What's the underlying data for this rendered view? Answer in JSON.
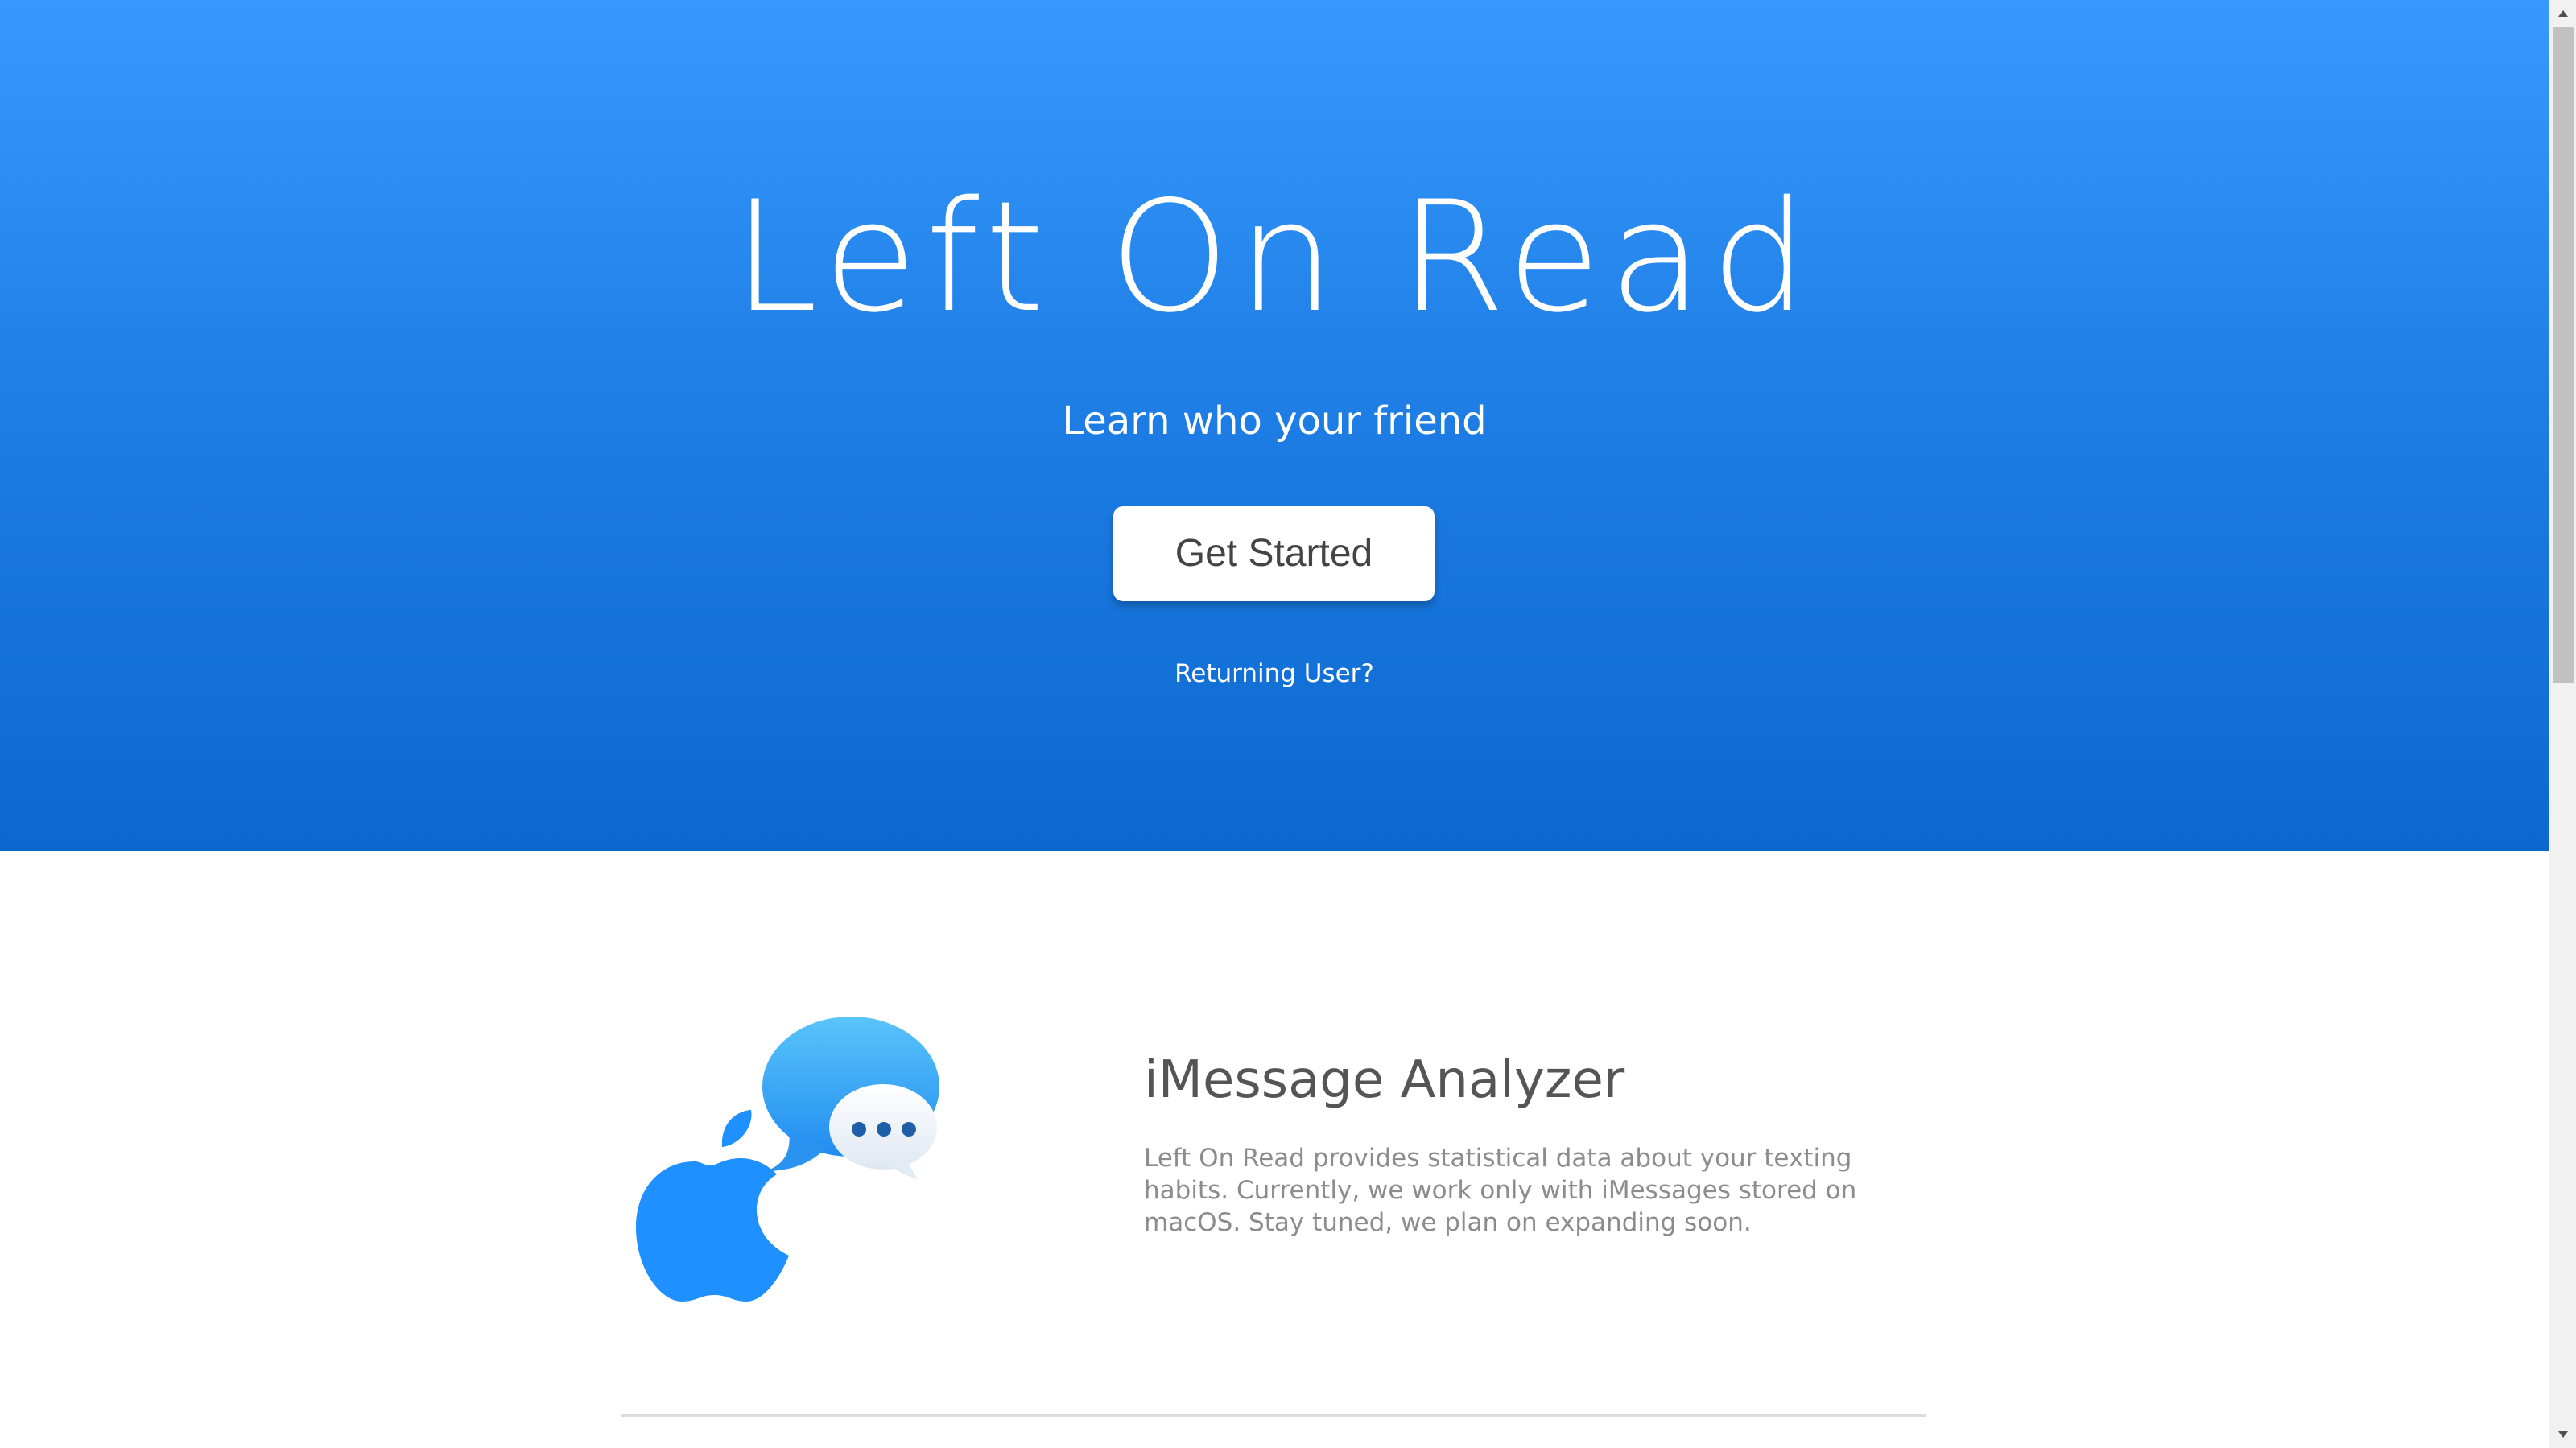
{
  "hero": {
    "title": "Left On Read",
    "subtitle": "Learn who your friend",
    "primary_button": "Get Started",
    "secondary_link": "Returning User?"
  },
  "feature": {
    "icon": "apple-imessage-icon",
    "title": "iMessage Analyzer",
    "description": "Left On Read provides statistical data about your texting habits. Currently, we work only with iMessages stored on macOS. Stay tuned, we plan on expanding soon."
  },
  "colors": {
    "hero_top": "#3799fd",
    "hero_bottom": "#0b68cf",
    "accent_blue": "#1e90ff"
  }
}
